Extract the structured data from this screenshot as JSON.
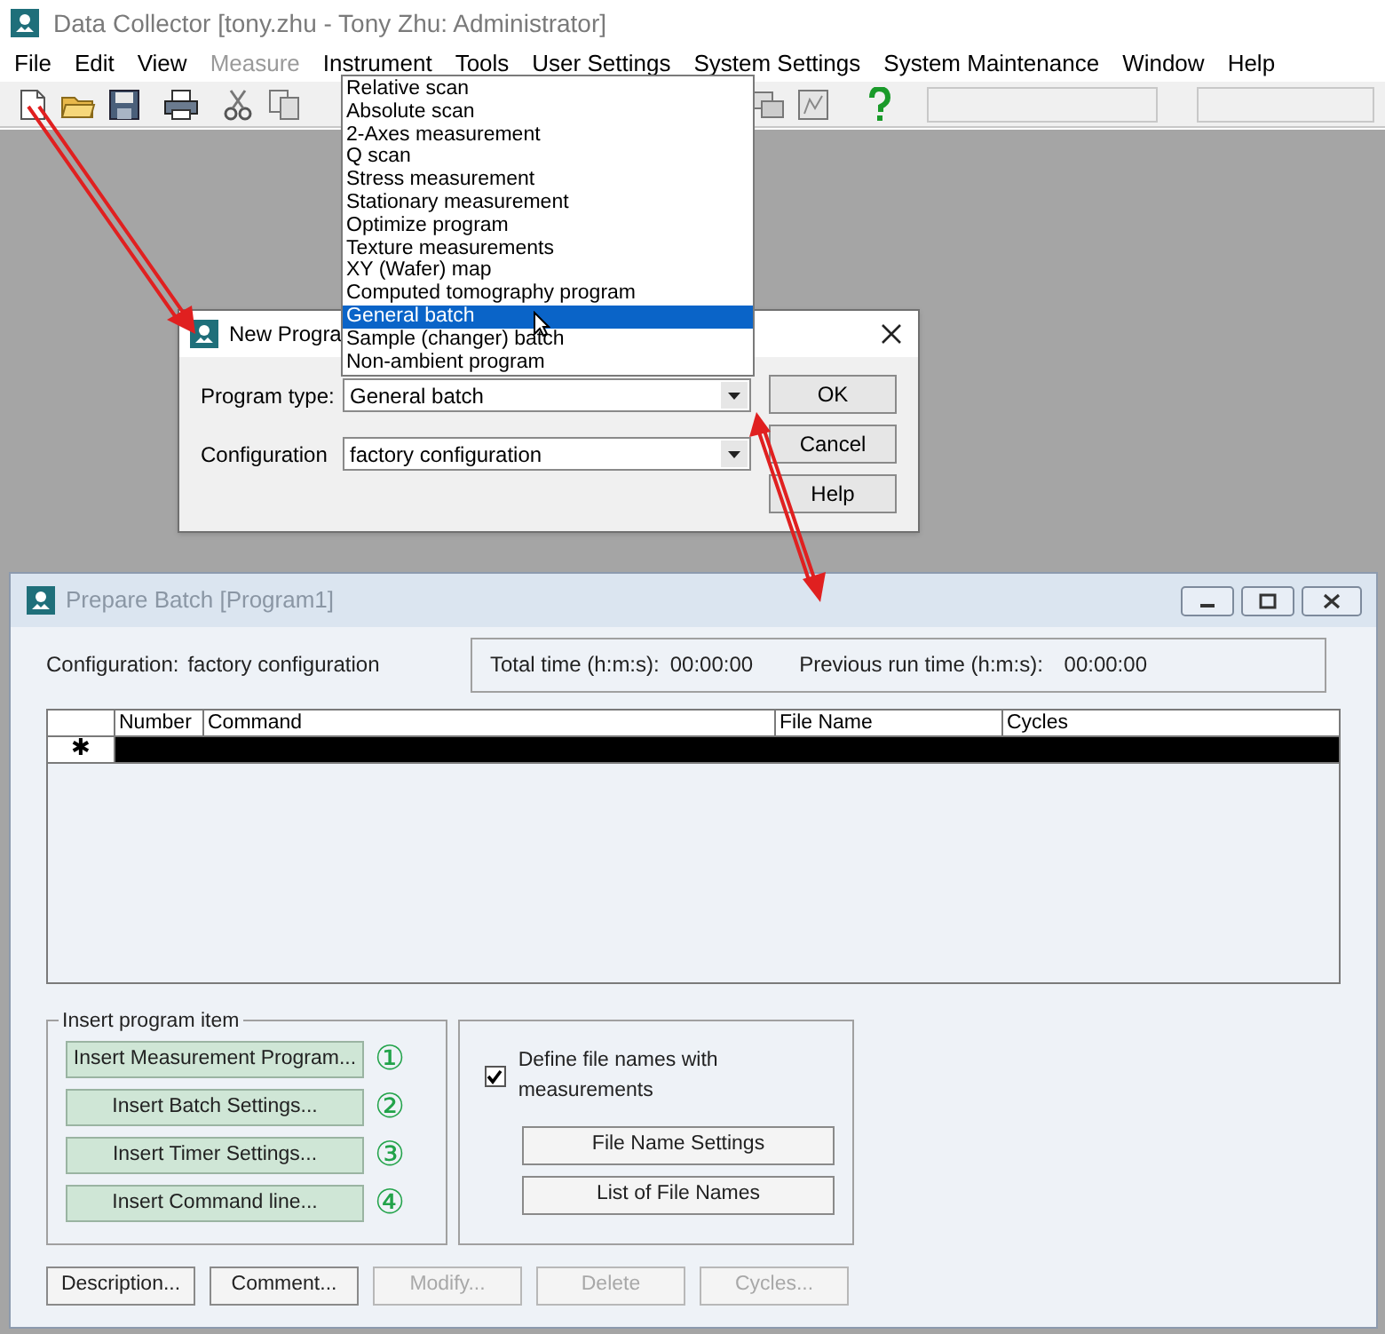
{
  "window": {
    "title": "Data Collector [tony.zhu - Tony Zhu: Administrator]"
  },
  "menu": [
    {
      "label": "File",
      "disabled": false
    },
    {
      "label": "Edit",
      "disabled": false
    },
    {
      "label": "View",
      "disabled": false
    },
    {
      "label": "Measure",
      "disabled": true
    },
    {
      "label": "Instrument",
      "disabled": false
    },
    {
      "label": "Tools",
      "disabled": false
    },
    {
      "label": "User Settings",
      "disabled": false
    },
    {
      "label": "System Settings",
      "disabled": false
    },
    {
      "label": "System Maintenance",
      "disabled": false
    },
    {
      "label": "Window",
      "disabled": false
    },
    {
      "label": "Help",
      "disabled": false
    }
  ],
  "dropdown": [
    {
      "label": "Relative scan",
      "selected": false
    },
    {
      "label": "Absolute scan",
      "selected": false
    },
    {
      "label": "2-Axes measurement",
      "selected": false
    },
    {
      "label": "Q scan",
      "selected": false
    },
    {
      "label": "Stress measurement",
      "selected": false
    },
    {
      "label": "Stationary measurement",
      "selected": false
    },
    {
      "label": "Optimize program",
      "selected": false
    },
    {
      "label": "Texture measurements",
      "selected": false
    },
    {
      "label": "XY (Wafer) map",
      "selected": false
    },
    {
      "label": "Computed tomography program",
      "selected": false
    },
    {
      "label": "General batch",
      "selected": true
    },
    {
      "label": "Sample (changer) batch",
      "selected": false
    },
    {
      "label": "Non-ambient program",
      "selected": false
    }
  ],
  "new_program_dialog": {
    "title": "New Progra",
    "fields": [
      {
        "label": "Program type:",
        "value": "General batch"
      },
      {
        "label": "Configuration",
        "value": "factory configuration"
      }
    ],
    "buttons": [
      "OK",
      "Cancel",
      "Help"
    ]
  },
  "prepare_batch": {
    "title": "Prepare Batch [Program1]",
    "configuration_label": "Configuration:",
    "configuration_value": "factory configuration",
    "total_time_label": "Total time (h:m:s):",
    "total_time": "00:00:00",
    "previous_run_label": "Previous run time (h:m:s):",
    "previous_run": "00:00:00",
    "table": {
      "columns": [
        "Number",
        "Command",
        "File Name",
        "Cycles"
      ],
      "rows": [
        {
          "marker": "✱",
          "selected": true
        }
      ]
    },
    "insert_group": {
      "title": "Insert program item",
      "buttons": [
        {
          "label": "Insert Measurement Program...",
          "step": "①"
        },
        {
          "label": "Insert Batch Settings...",
          "step": "②"
        },
        {
          "label": "Insert Timer Settings...",
          "step": "③"
        },
        {
          "label": "Insert Command line...",
          "step": "④"
        }
      ]
    },
    "checkbox": {
      "label": "Define file names with measurements",
      "checked": true
    },
    "file_buttons": [
      "File Name Settings",
      "List of File Names"
    ],
    "bottom_buttons": [
      {
        "label": "Description...",
        "disabled": false
      },
      {
        "label": "Comment...",
        "disabled": false
      },
      {
        "label": "Modify...",
        "disabled": true
      },
      {
        "label": "Delete",
        "disabled": true
      },
      {
        "label": "Cycles...",
        "disabled": true
      }
    ]
  }
}
